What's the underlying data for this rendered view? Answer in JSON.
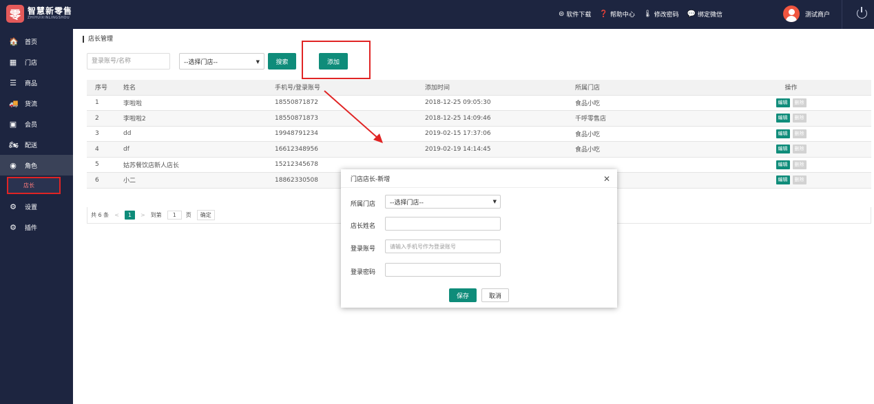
{
  "colors": {
    "navbar": "#1d2540",
    "accent": "#0f8c7a",
    "highlight": "#e02424"
  },
  "brand": {
    "mark": "零",
    "name": "智慧新零售",
    "name_en": "ZHIHUIXINLINGSHOU"
  },
  "header": {
    "links": [
      {
        "icon": "download-icon",
        "glyph": "⊜",
        "label": "软件下载"
      },
      {
        "icon": "help-icon",
        "glyph": "❓",
        "label": "帮助中心"
      },
      {
        "icon": "thermometer-icon",
        "glyph": "🌡",
        "label": "修改密码"
      },
      {
        "icon": "wechat-icon",
        "glyph": "💬",
        "label": "绑定微信"
      }
    ],
    "user_name": "测试商户"
  },
  "sidebar": {
    "items": [
      {
        "icon": "home-icon",
        "glyph": "🏠",
        "label": "首页"
      },
      {
        "icon": "store-icon",
        "glyph": "▦",
        "label": "门店"
      },
      {
        "icon": "list-icon",
        "glyph": "☰",
        "label": "商品"
      },
      {
        "icon": "truck-icon",
        "glyph": "🚚",
        "label": "货流"
      },
      {
        "icon": "member-card-icon",
        "glyph": "▣",
        "label": "会员"
      },
      {
        "icon": "motorcycle-icon",
        "glyph": "🏍",
        "label": "配送"
      },
      {
        "icon": "user-circle-icon",
        "glyph": "◉",
        "label": "角色"
      },
      {
        "icon": "gear-icon",
        "glyph": "⚙",
        "label": "设置"
      },
      {
        "icon": "plugin-icon",
        "glyph": "⚙",
        "label": "插件"
      }
    ],
    "sub_item": "店长"
  },
  "main": {
    "breadcrumb": "店长管理",
    "search_placeholder": "登录账号/名称",
    "store_select": "--选择门店--",
    "search_button": "搜索",
    "add_button": "添加"
  },
  "table": {
    "headers": [
      "序号",
      "姓名",
      "手机号/登录账号",
      "添加时间",
      "所属门店",
      "操作"
    ],
    "rows": [
      [
        "1",
        "李啦啦",
        "18550871872",
        "2018-12-25 09:05:30",
        "食品小吃"
      ],
      [
        "2",
        "李啦啦2",
        "18550871873",
        "2018-12-25 14:09:46",
        "千呼零售店"
      ],
      [
        "3",
        "dd",
        "19948791234",
        "2019-02-15 17:37:06",
        "食品小吃"
      ],
      [
        "4",
        "df",
        "16612348956",
        "2019-02-19 14:14:45",
        "食品小吃"
      ],
      [
        "5",
        "姑苏餐饮店新人店长",
        "15212345678",
        "",
        ""
      ],
      [
        "6",
        "小二",
        "18862330508",
        "",
        ""
      ]
    ],
    "edit_label": "编辑",
    "delete_label": "删除"
  },
  "pager": {
    "total": "共 6 条",
    "current": "1",
    "goto": "到第",
    "page_input": "1",
    "page_unit": "页",
    "confirm": "确定"
  },
  "modal": {
    "title": "门店店长-新增",
    "store_label": "所属门店",
    "store_value": "--选择门店--",
    "name_label": "店长姓名",
    "account_label": "登录账号",
    "account_placeholder": "请输入手机号作为登录账号",
    "password_label": "登录密码",
    "save": "保存",
    "cancel": "取消"
  }
}
